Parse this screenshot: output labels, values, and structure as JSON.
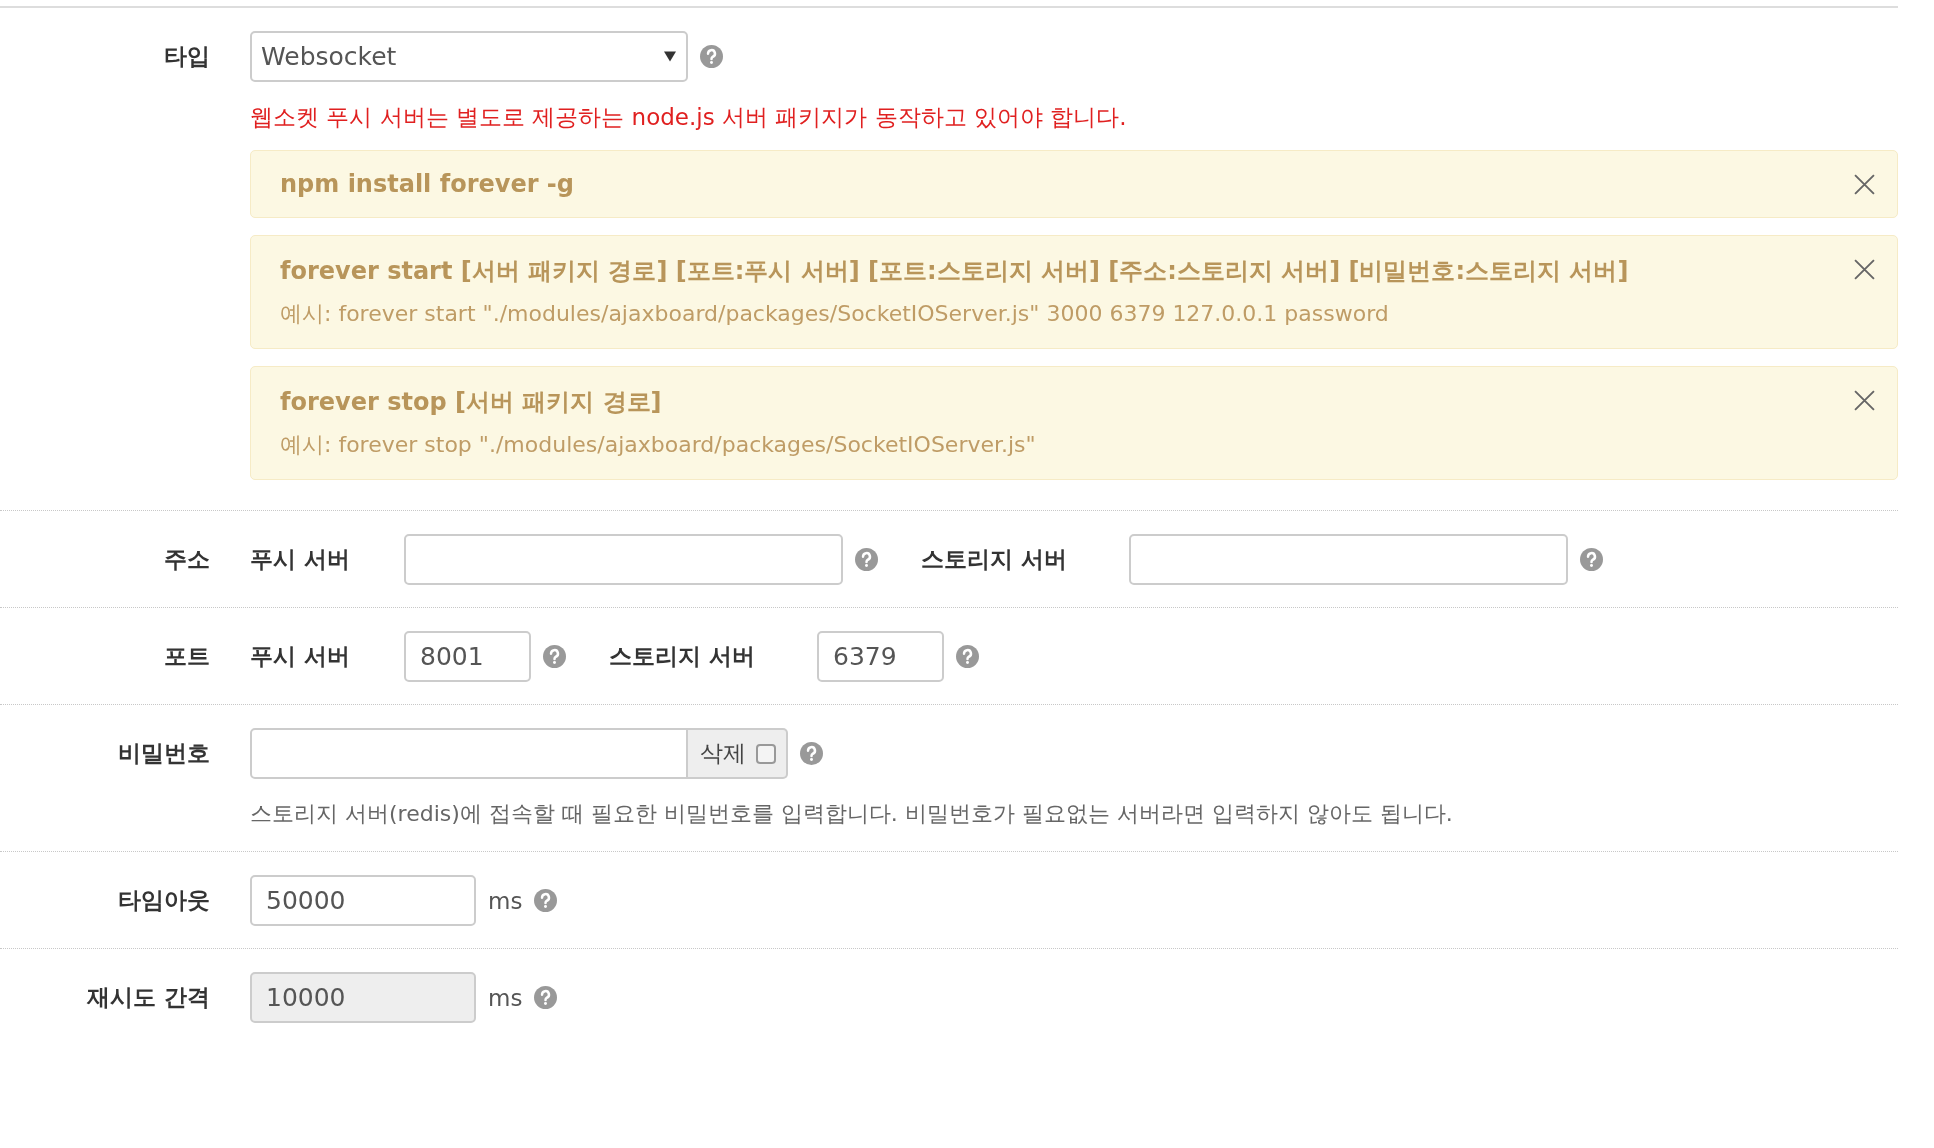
{
  "rows": [
    {
      "kind": "select",
      "label": "타입",
      "value": "Websocket",
      "note": "웹소켓 푸시 서버는 별도로 제공하는 node.js 서버 패키지가 동작하고 있어야 합니다.",
      "alerts": [
        {
          "command": "npm install forever -g"
        },
        {
          "command": "forever start [서버 패키지 경로] [포트:푸시 서버] [포트:스토리지 서버] [주소:스토리지 서버] [비밀번호:스토리지 서버]",
          "example": "예시: forever start \"./modules/ajaxboard/packages/SocketIOServer.js\" 3000 6379 127.0.0.1 password"
        },
        {
          "command": "forever stop [서버 패키지 경로]",
          "example": "예시: forever stop \"./modules/ajaxboard/packages/SocketIOServer.js\""
        }
      ]
    },
    {
      "kind": "host",
      "label": "주소",
      "fields": [
        {
          "label": "푸시 서버"
        },
        {
          "label": "스토리지 서버"
        }
      ]
    },
    {
      "kind": "port",
      "label": "포트",
      "fields": [
        {
          "label": "푸시 서버",
          "value": "8001"
        },
        {
          "label": "스토리지 서버",
          "value": "6379"
        }
      ]
    },
    {
      "kind": "password",
      "label": "비밀번호",
      "addon": "삭제",
      "checked": false,
      "hint": "스토리지 서버(redis)에 접속할 때 필요한 비밀번호를 입력합니다. 비밀번호가 필요없는 서버라면 입력하지 않아도 됩니다."
    },
    {
      "kind": "number",
      "label": "타임아웃",
      "value": "50000",
      "unit": "ms",
      "disabled": false
    },
    {
      "kind": "number",
      "label": "재시도 간격",
      "value": "10000",
      "unit": "ms",
      "disabled": true
    }
  ]
}
